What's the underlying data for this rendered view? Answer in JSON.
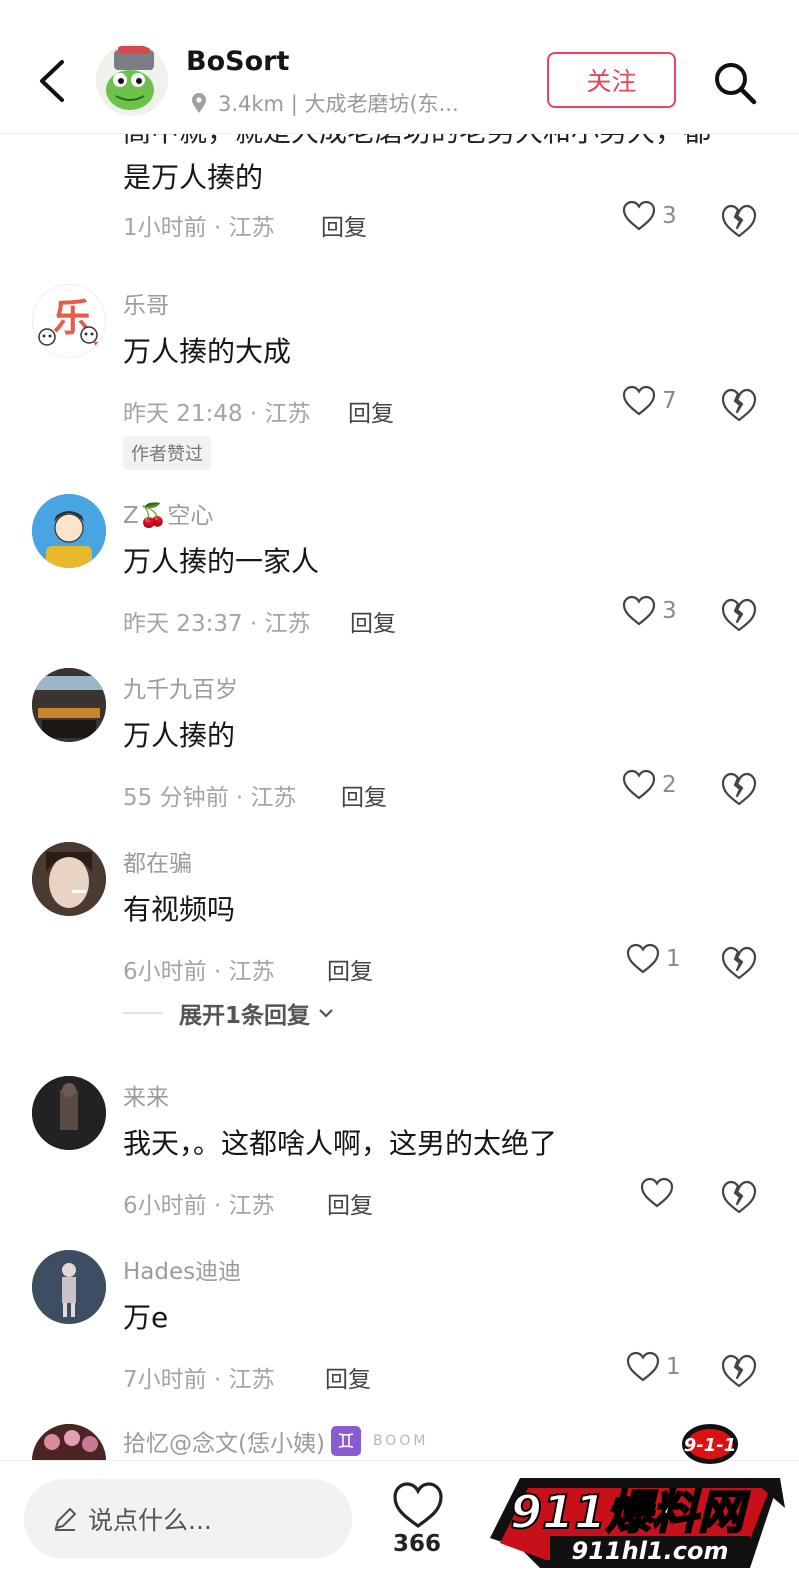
{
  "header": {
    "username": "BoSort",
    "location": "3.4km | 大成老磨坊(东...",
    "follow_label": "关注"
  },
  "partial_comment": {
    "text_line1": "高中就，就是大成老磨坊的老男大和小男大，都",
    "text_line2": "是万人揍的",
    "time": "1小时前 · 江苏",
    "reply": "回复",
    "likes": "3"
  },
  "comments": [
    {
      "user": "乐哥",
      "text": "万人揍的大成",
      "time": "昨天 21:48 · 江苏",
      "reply": "回复",
      "likes": "7",
      "badge": "作者赞过"
    },
    {
      "user": "Z🍒空心",
      "text": "万人揍的一家人",
      "time": "昨天 23:37 · 江苏",
      "reply": "回复",
      "likes": "3"
    },
    {
      "user": "九千九百岁",
      "text": "万人揍的",
      "time": "55 分钟前 · 江苏",
      "reply": "回复",
      "likes": "2"
    },
    {
      "user": "都在骗",
      "text": "有视频吗",
      "time": "6小时前 · 江苏",
      "reply": "回复",
      "likes": "1"
    },
    {
      "user": "来来",
      "text": "我天，。这都啥人啊，这男的太绝了",
      "time": "6小时前 · 江苏",
      "reply": "回复",
      "likes": ""
    },
    {
      "user": "Hades迪迪",
      "text": "万e",
      "time": "7小时前 · 江苏",
      "reply": "回复",
      "likes": "1"
    },
    {
      "user": "拾忆@念文(恁小姨)",
      "text": "",
      "time": "",
      "reply": "",
      "likes": ""
    }
  ],
  "expand_replies": "展开1条回复",
  "zodiac_badge": "♊",
  "boom_tag": "BOOM",
  "bottom": {
    "input_placeholder": "说点什么...",
    "like_count": "366"
  },
  "watermark": {
    "badge": "9-1-1",
    "title": "911爆料网",
    "url": "911hl1.com"
  },
  "colors": {
    "accent": "#e8465a",
    "muted": "#9c9c9c"
  }
}
